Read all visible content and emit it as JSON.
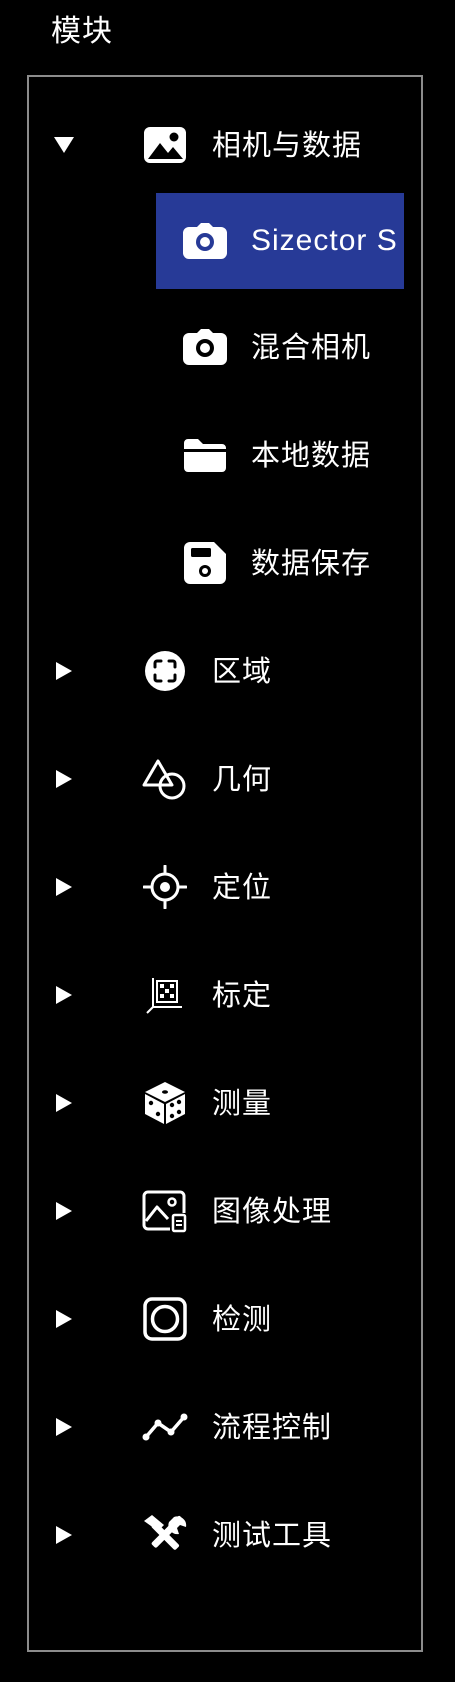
{
  "panel": {
    "title": "模块"
  },
  "tree": {
    "camera_data": {
      "label": "相机与数据",
      "expanded": true,
      "icon": "image-icon",
      "children": [
        {
          "label": "Sizector S",
          "icon": "camera-icon",
          "selected": true
        },
        {
          "label": "混合相机",
          "icon": "camera-icon"
        },
        {
          "label": "本地数据",
          "icon": "folder-icon"
        },
        {
          "label": "数据保存",
          "icon": "floppy-disk-icon"
        }
      ]
    },
    "region": {
      "label": "区域",
      "icon": "region-focus-icon"
    },
    "geometry": {
      "label": "几何",
      "icon": "shapes-icon"
    },
    "locate": {
      "label": "定位",
      "icon": "crosshair-icon"
    },
    "calibrate": {
      "label": "标定",
      "icon": "calibration-board-icon"
    },
    "measure": {
      "label": "测量",
      "icon": "dice-icon"
    },
    "image_processing": {
      "label": "图像处理",
      "icon": "image-edit-icon"
    },
    "inspect": {
      "label": "检测",
      "icon": "inspect-frame-icon"
    },
    "flow_control": {
      "label": "流程控制",
      "icon": "polyline-icon"
    },
    "test_tools": {
      "label": "测试工具",
      "icon": "tools-icon"
    }
  },
  "colors": {
    "background": "#000000",
    "frame_border": "#8c8c8c",
    "selection": "#273a97",
    "text": "#ffffff"
  }
}
